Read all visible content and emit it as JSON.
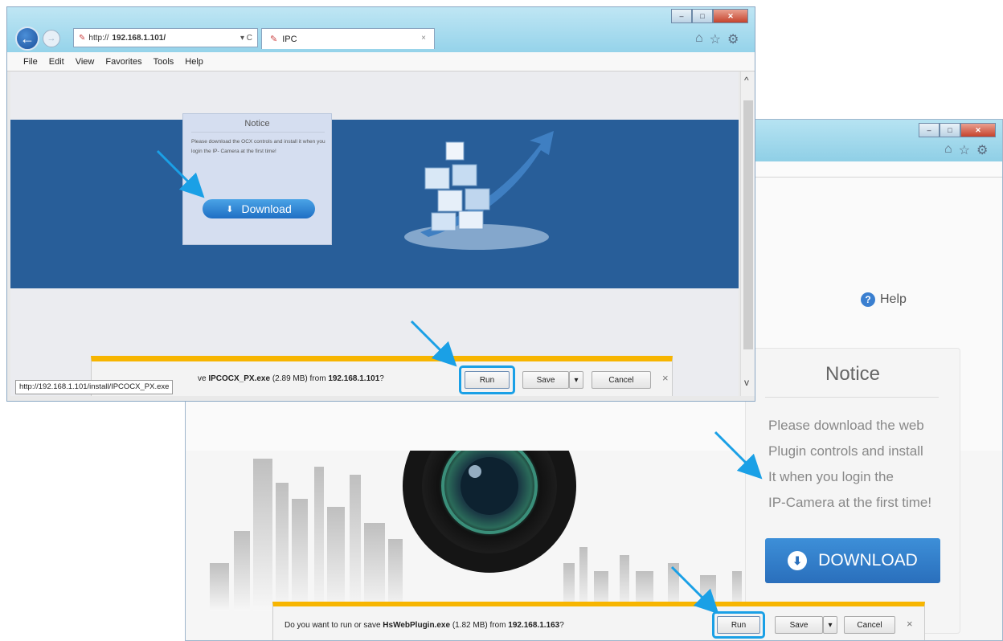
{
  "colors": {
    "accent": "#1aa0e6",
    "banner": "#285e99",
    "warning_bar": "#f7b500",
    "download_button": "#2a6fbc"
  },
  "window1": {
    "address": {
      "prefix": "http://",
      "host": "192.168.1.101/",
      "controls": "▾ C"
    },
    "tab_title": "IPC",
    "tab_close": "×",
    "menu": [
      "File",
      "Edit",
      "View",
      "Favorites",
      "Tools",
      "Help"
    ],
    "notice": {
      "title": "Notice",
      "text": "Please download the OCX controls and install it when you login the IP- Camera at the first time!",
      "download_label": "Download"
    },
    "status_url": "http://192.168.1.101/install/IPCOCX_PX.exe",
    "download_bar": {
      "prompt_prefix": "ve",
      "file": "IPCOCX_PX.exe",
      "size": "(2.89 MB) from",
      "host": "192.168.1.101",
      "suffix": "?",
      "run_label": "Run",
      "save_label": "Save",
      "cancel_label": "Cancel",
      "close": "×"
    },
    "window_buttons": {
      "minimize": "–",
      "maximize": "□",
      "close": "✕"
    }
  },
  "window2": {
    "help_label": "Help",
    "notice": {
      "title": "Notice",
      "lines": [
        "Please download the web",
        "Plugin controls and install",
        "It when you login the",
        "IP-Camera at the first time!"
      ],
      "download_label": "DOWNLOAD"
    },
    "download_bar": {
      "prompt_prefix": "Do you want to run or save",
      "file": "HsWebPlugin.exe",
      "size": "(1.82 MB) from",
      "host": "192.168.1.163",
      "suffix": "?",
      "run_label": "Run",
      "save_label": "Save",
      "cancel_label": "Cancel",
      "close": "×"
    },
    "window_buttons": {
      "minimize": "–",
      "maximize": "□",
      "close": "✕"
    }
  },
  "icons": [
    "back-arrow-icon",
    "forward-arrow-icon",
    "home-icon",
    "favorites-star-icon",
    "settings-gear-icon",
    "download-arrow-icon",
    "help-question-icon",
    "annotation-arrow-icon"
  ]
}
